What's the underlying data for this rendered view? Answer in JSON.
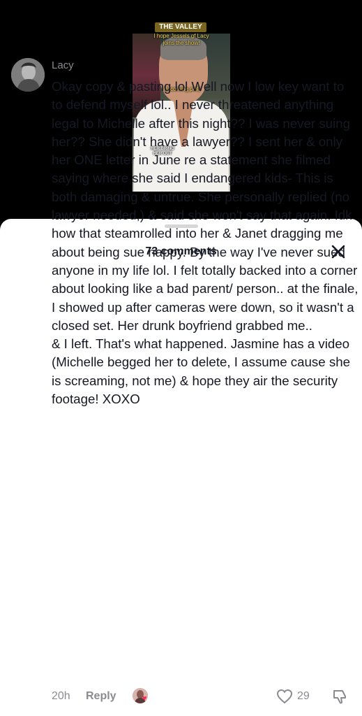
{
  "video": {
    "show_title": "THE VALLEY",
    "caption_top": "I hope Jessels gf Lacy joins the show!",
    "caption_mid": "(Incoming poll)",
    "caption_small": "HER BRING HER OUT"
  },
  "sheet": {
    "comments_count": "73 comments"
  },
  "comment": {
    "username": "Lacy",
    "text": "Okay copy & pasting lol Well now I low key want to to defend myself lol.. I never threatened anything legal to Michelle after this night?? I was never suing her?? She didn't have a lawyer?? I sent her & only her ONE letter in June re a statement she filmed saying where she said I endangered kids- This is both damaging & untrue. She personally replied (no lawyer needed,) & said she won't say that again. Idk how that steamrolled into her & Janet dragging me about being sue happy. By the way I've never sued anyone in my life lol. I felt totally backed into a corner about looking like a bad parent/ person.. at the finale, I showed up after cameras were down, so it wasn't a closed set. Her drunk boyfriend grabbed me..\n& I left. That's what happened. Jasmine has a video (Michelle begged her to delete, I assume cause she is screaming, not me) & hope they air the security footage! XOXO",
    "time": "20h",
    "reply_label": "Reply",
    "like_count": "29"
  },
  "icons": {
    "close": "close-icon",
    "like": "heart-outline-icon",
    "dislike": "thumbs-down-icon",
    "heart_badge": "heart-icon"
  },
  "colors": {
    "heart_badge": "#fe2c55",
    "muted_text": "#8a8b91",
    "main_text": "#161823"
  }
}
